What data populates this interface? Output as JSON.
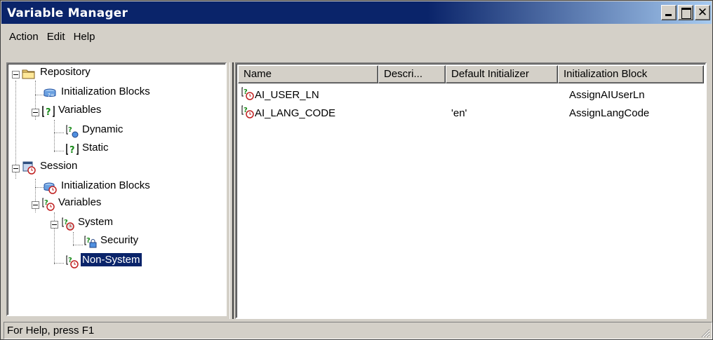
{
  "window": {
    "title": "Variable Manager"
  },
  "menubar": {
    "items": [
      "Action",
      "Edit",
      "Help"
    ]
  },
  "tree": {
    "repository": "Repository",
    "repo_init_blocks": "Initialization Blocks",
    "repo_variables": "Variables",
    "repo_dynamic": "Dynamic",
    "repo_static": "Static",
    "session": "Session",
    "session_init_blocks": "Initialization Blocks",
    "session_variables": "Variables",
    "session_system": "System",
    "session_security": "Security",
    "session_nonsystem": "Non-System",
    "selected": "Non-System"
  },
  "list": {
    "columns": [
      "Name",
      "Descri...",
      "Default Initializer",
      "Initialization Block"
    ],
    "rows": [
      {
        "name": "AI_USER_LN",
        "description": "",
        "default": "",
        "block": "AssignAIUserLn"
      },
      {
        "name": "AI_LANG_CODE",
        "description": "",
        "default": "'en'",
        "block": "AssignLangCode"
      }
    ]
  },
  "status": {
    "text": "For Help, press F1"
  },
  "colors": {
    "titlebar": "#0a246a",
    "selection": "#0a246a",
    "chrome": "#d4d0c8"
  },
  "icons": [
    "folder-icon",
    "init-block-icon",
    "variable-icon",
    "dynamic-variable-icon",
    "static-variable-icon",
    "session-icon",
    "session-variable-icon",
    "system-variable-icon",
    "security-variable-icon",
    "nonsystem-variable-icon"
  ]
}
